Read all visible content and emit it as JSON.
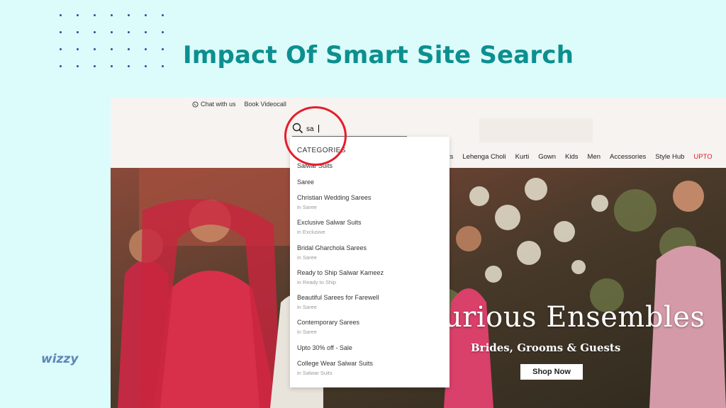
{
  "slide": {
    "title": "Impact Of Smart Site Search",
    "logo": "wizzy"
  },
  "site": {
    "topbar": {
      "chat": "Chat with us",
      "videocall": "Book Videocall"
    },
    "search": {
      "value": "sa"
    },
    "nav": {
      "items": [
        "ts",
        "Lehenga Choli",
        "Kurti",
        "Gown",
        "Kids",
        "Men",
        "Accessories",
        "Style Hub",
        "UPTO"
      ]
    },
    "dropdown": {
      "heading": "CATEGORIES",
      "items": [
        {
          "label": "Salwar Suits",
          "sub": ""
        },
        {
          "label": "Saree",
          "sub": ""
        },
        {
          "label": "Christian Wedding Sarees",
          "sub": "in  Saree"
        },
        {
          "label": "Exclusive Salwar Suits",
          "sub": "in  Exclusive"
        },
        {
          "label": "Bridal Gharchola Sarees",
          "sub": "in  Saree"
        },
        {
          "label": "Ready to Ship Salwar Kameez",
          "sub": "in  Ready to Ship"
        },
        {
          "label": "Beautiful Sarees for Farewell",
          "sub": "in  Saree"
        },
        {
          "label": "Contemporary Sarees",
          "sub": "in  Saree"
        },
        {
          "label": "Upto 30% off - Sale",
          "sub": ""
        },
        {
          "label": "College Wear Salwar Suits",
          "sub": "in  Salwar Suits"
        }
      ]
    },
    "hero": {
      "title": "urious Ensembles",
      "subtitle": "Brides, Grooms & Guests",
      "cta": "Shop Now"
    }
  },
  "colors": {
    "background": "#dcfbfb",
    "title": "#0c8f8f",
    "highlight": "#e51d2c"
  }
}
